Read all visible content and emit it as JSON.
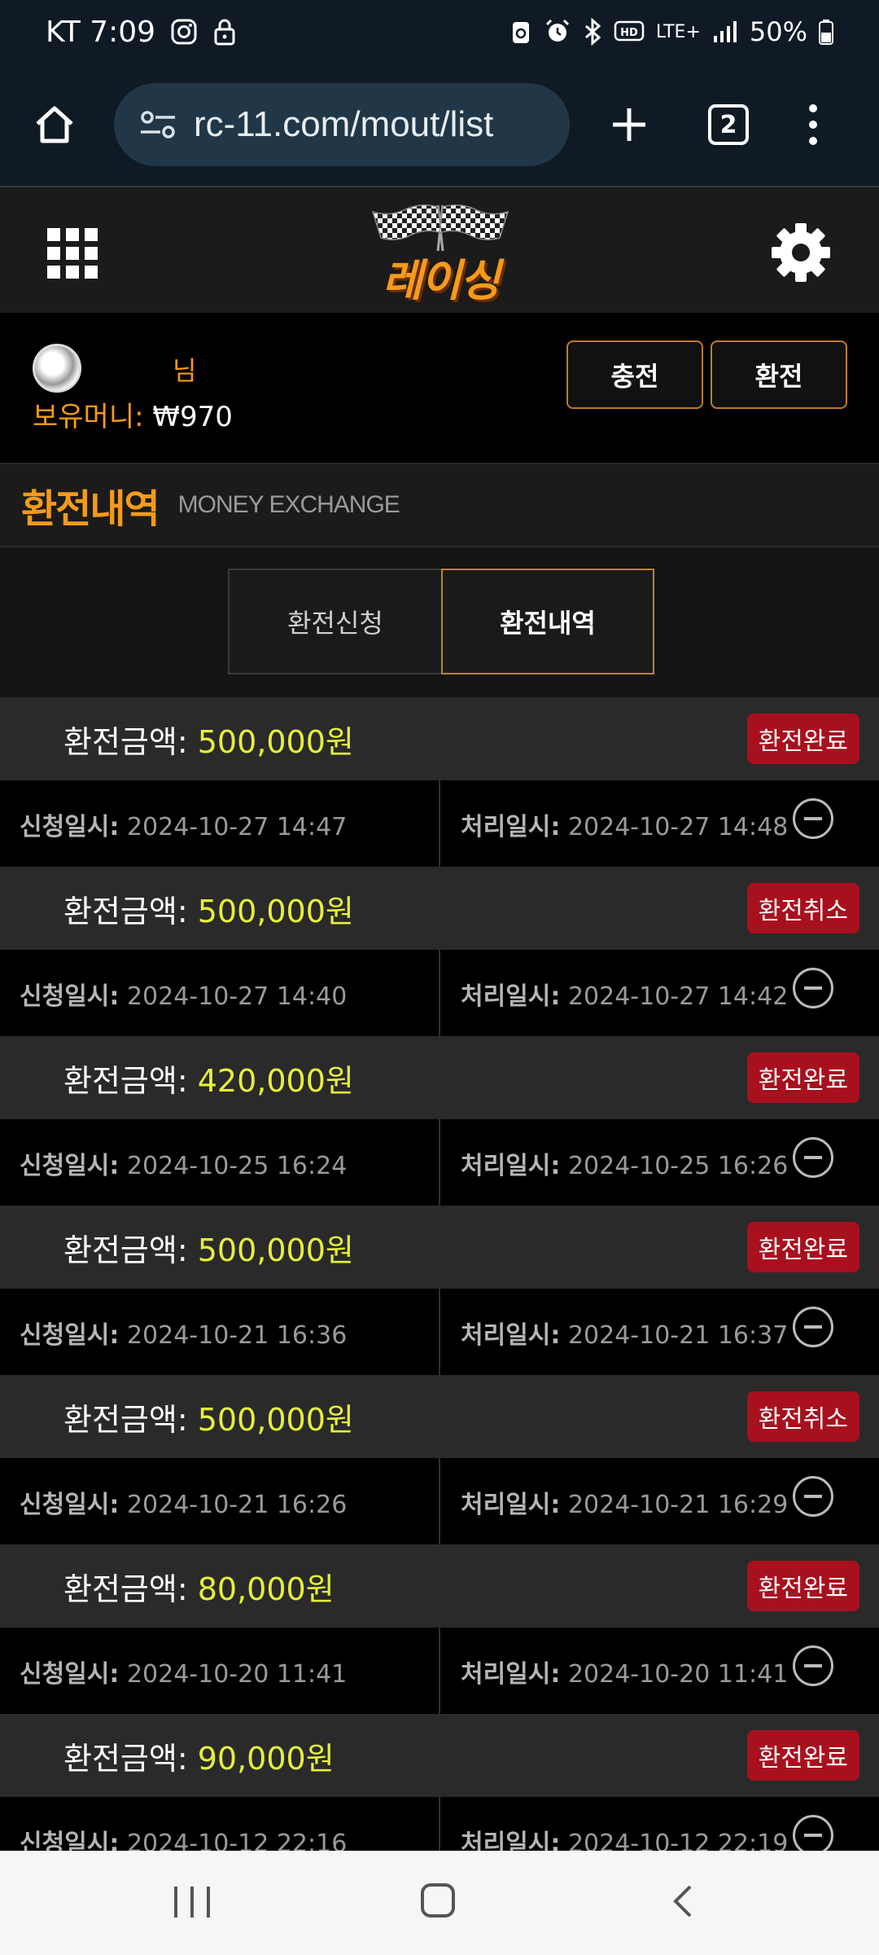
{
  "status_bar": {
    "carrier_time": "KT 7:09",
    "network": "LTE+",
    "battery": "50%"
  },
  "browser": {
    "url": "rc-11.com/mout/list",
    "tab_count": "2"
  },
  "site": {
    "logo_text": "레이싱"
  },
  "user": {
    "name_suffix": "님",
    "money_label": "보유머니:",
    "money_value": "₩970"
  },
  "actions": {
    "charge_label": "충전",
    "exchange_label": "환전"
  },
  "section": {
    "title_ko": "환전내역",
    "title_en": "MONEY EXCHANGE"
  },
  "tabs": {
    "apply_label": "환전신청",
    "history_label": "환전내역"
  },
  "labels": {
    "amount": "환전금액:",
    "requested": "신청일시:",
    "processed": "처리일시:"
  },
  "records": [
    {
      "amount": "500,000원",
      "status": "환전완료",
      "requested": "2024-10-27 14:47",
      "processed": "2024-10-27 14:48"
    },
    {
      "amount": "500,000원",
      "status": "환전취소",
      "requested": "2024-10-27 14:40",
      "processed": "2024-10-27 14:42"
    },
    {
      "amount": "420,000원",
      "status": "환전완료",
      "requested": "2024-10-25 16:24",
      "processed": "2024-10-25 16:26"
    },
    {
      "amount": "500,000원",
      "status": "환전완료",
      "requested": "2024-10-21 16:36",
      "processed": "2024-10-21 16:37"
    },
    {
      "amount": "500,000원",
      "status": "환전취소",
      "requested": "2024-10-21 16:26",
      "processed": "2024-10-21 16:29"
    },
    {
      "amount": "80,000원",
      "status": "환전완료",
      "requested": "2024-10-20 11:41",
      "processed": "2024-10-20 11:41"
    },
    {
      "amount": "90,000원",
      "status": "환전완료",
      "requested": "2024-10-12 22:16",
      "processed": "2024-10-12 22:19"
    }
  ],
  "icons": {
    "status": [
      "instagram-icon",
      "lock-icon",
      "recycle-icon",
      "alarm-icon",
      "bluetooth-icon",
      "hd-voice-icon",
      "signal-icon",
      "battery-icon"
    ],
    "browser": [
      "home-icon",
      "site-settings-icon",
      "plus-icon",
      "tabs-icon",
      "more-vert-icon"
    ],
    "header": [
      "grid-menu-icon",
      "checkered-flags-icon",
      "gear-icon"
    ]
  },
  "colors": {
    "accent": "#f59a1b",
    "amount": "#e6f03a",
    "badge": "#a8101e",
    "tab_border": "#b8862b"
  }
}
